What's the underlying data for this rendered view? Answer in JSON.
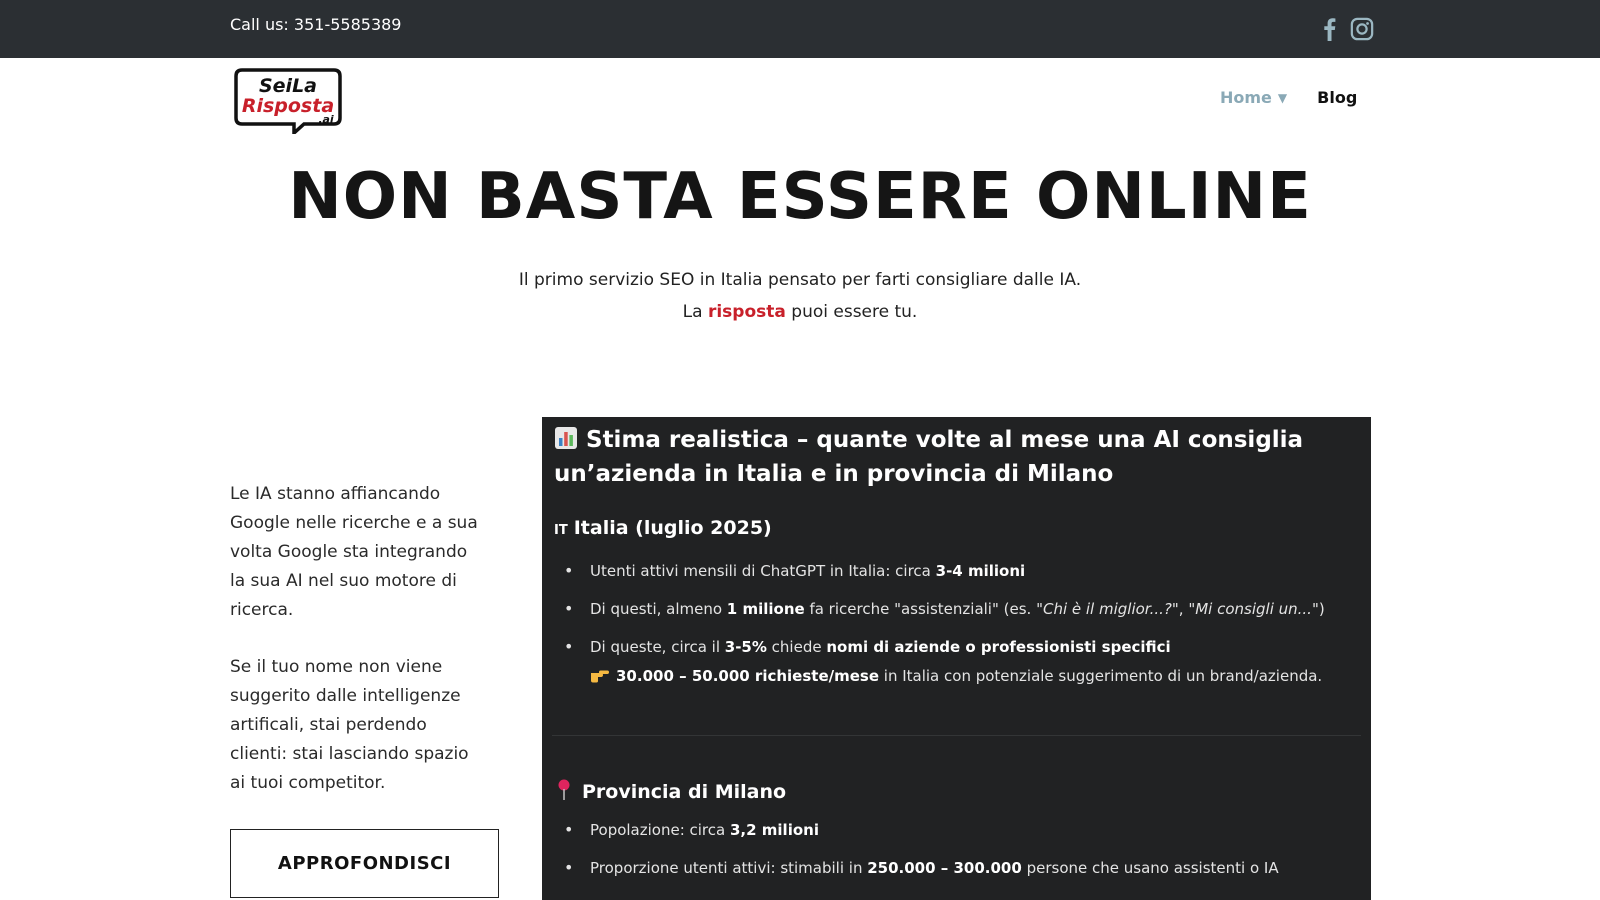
{
  "topbar": {
    "phone": "Call us: 351-5585389",
    "social": [
      "facebook-icon",
      "instagram-icon"
    ]
  },
  "header": {
    "logo_text": {
      "line1": "SeiLa",
      "line2": "Risposta",
      "line3": ".ai"
    },
    "nav": [
      {
        "label": "Home",
        "has_dropdown": true,
        "active": true
      },
      {
        "label": "Blog",
        "has_dropdown": false,
        "active": false
      }
    ]
  },
  "hero": {
    "title": "NON BASTA ESSERE ONLINE",
    "subtitle_line1": "Il primo servizio SEO in Italia pensato per farti consigliare dalle IA.",
    "subtitle_line2_pre": "La ",
    "subtitle_line2_accent": "risposta",
    "subtitle_line2_post": " puoi essere tu."
  },
  "left": {
    "para1": "Le IA stanno affiancando Google nelle ricerche e a sua volta Google sta integrando la sua AI nel suo motore di ricerca.",
    "para2": "Se il tuo nome non viene suggerito dalle intelligenze artificali, stai perdendo clienti: stai lasciando spazio ai tuoi competitor.",
    "cta": "APPROFONDISCI"
  },
  "panel": {
    "title": "Stima realistica – quante volte al mese una AI consiglia un’azienda in Italia e in provincia di Milano",
    "italy": {
      "flag": "IT",
      "heading": "Italia (luglio 2025)",
      "b1_pre": "Utenti attivi mensili di ChatGPT in Italia: circa ",
      "b1_bold": "3-4 milioni",
      "b2_pre": "Di questi, almeno ",
      "b2_bold": "1 milione",
      "b2_mid": " fa ricerche \"assistenziali\" (es. ",
      "b2_q1": "\"Chi è il miglior...?\"",
      "b2_sep": ", ",
      "b2_q2": "\"Mi consigli un...\"",
      "b2_end": ")",
      "b3_pre": "Di queste, circa il ",
      "b3_bold1": "3-5%",
      "b3_mid": " chiede ",
      "b3_bold2": "nomi di aziende o professionisti specifici",
      "b3_line2_bold": "30.000 – 50.000 richieste/mese",
      "b3_line2_post": " in Italia con potenziale suggerimento di un brand/azienda."
    },
    "milano": {
      "heading": "Provincia di Milano",
      "b1_pre": "Popolazione: circa ",
      "b1_bold": "3,2 milioni",
      "b2_pre": "Proporzione utenti attivi: stimabili in ",
      "b2_bold": "250.000 – 300.000",
      "b2_post": " persone che usano assistenti o IA"
    }
  },
  "colors": {
    "topbar_bg": "#2b2f33",
    "accent_red": "#c8202a",
    "nav_active": "#8aa9b6",
    "panel_bg": "#212223"
  }
}
